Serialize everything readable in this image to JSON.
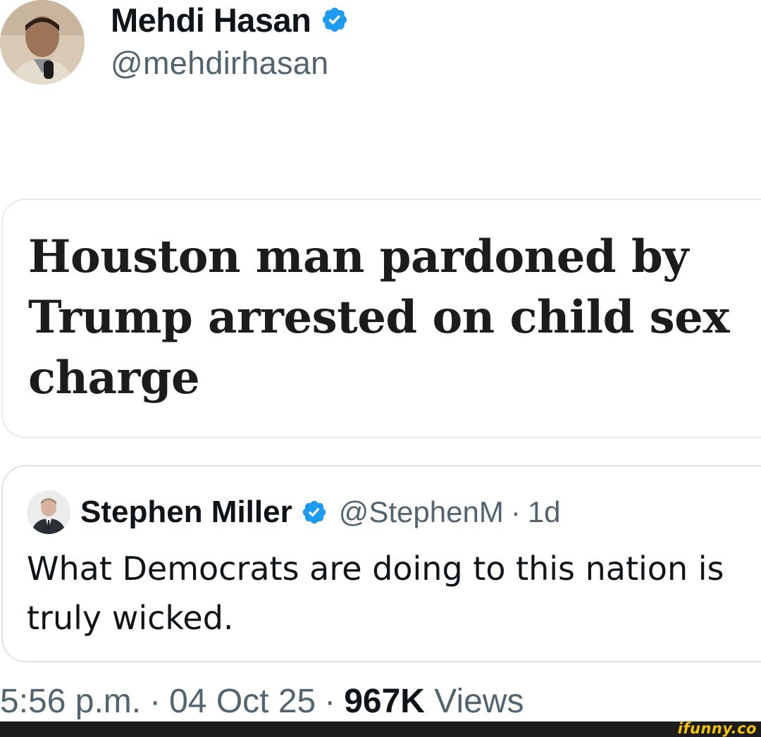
{
  "author": {
    "name": "Mehdi Hasan",
    "handle": "@mehdirhasan",
    "avatar_icon": "person-avatar-icon"
  },
  "link_card": {
    "headline": "Houston man pardoned by Trump arrested on child sex charge"
  },
  "quoted_tweet": {
    "name": "Stephen Miller",
    "handle": "@StephenM",
    "separator": "·",
    "time": "1d",
    "text": "What Democrats are doing to this nation is truly wicked."
  },
  "meta": {
    "time": "5:56 p.m.",
    "separator": "·",
    "date": "04 Oct 25",
    "views_count": "967K",
    "views_label": "Views"
  },
  "watermark": {
    "text": "ifunny.co"
  },
  "colors": {
    "verified_badge": "#1d9bf0",
    "text_primary": "#0f1419",
    "text_secondary": "#536471",
    "card_border": "#e6ebee",
    "watermark_bar": "#1c1c1c",
    "watermark_text": "#f5c400"
  }
}
